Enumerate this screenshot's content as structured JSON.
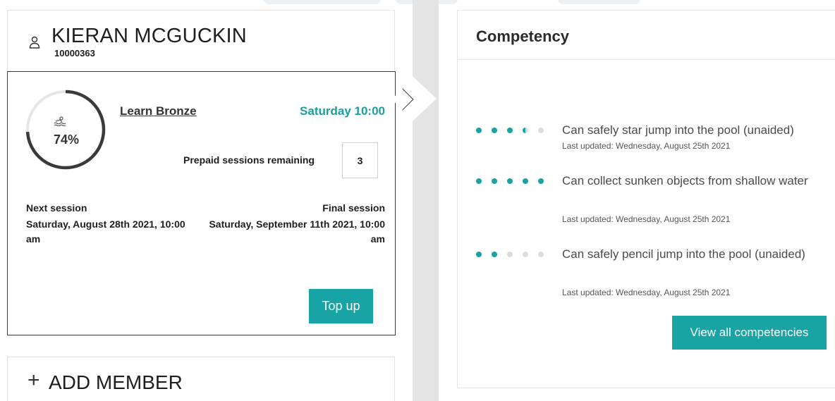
{
  "member": {
    "name": "KIERAN MCGUCKIN",
    "id": "10000363"
  },
  "course": {
    "name": "Learn Bronze",
    "time": "Saturday 10:00",
    "progress": 74,
    "progress_label": "74%",
    "prepaid_label": "Prepaid sessions remaining",
    "prepaid_count": "3",
    "next_label": "Next session",
    "next_value": "Saturday, August 28th 2021, 10:00 am",
    "final_label": "Final session",
    "final_value": "Saturday, September 11th 2021, 10:00 am",
    "topup_label": "Top up"
  },
  "add_member": {
    "label": "ADD MEMBER"
  },
  "competency": {
    "title": "Competency",
    "items": [
      {
        "text": "Can safely star jump into the pool (unaided)",
        "updated": "Last updated: Wednesday, August 25th 2021",
        "level": 3.5,
        "max": 5
      },
      {
        "text": "Can collect sunken objects from shallow water",
        "updated": "Last updated: Wednesday, August 25th 2021",
        "level": 5,
        "max": 5
      },
      {
        "text": "Can safely pencil jump into the pool (unaided)",
        "updated": "Last updated: Wednesday, August 25th 2021",
        "level": 2,
        "max": 5
      }
    ],
    "view_all_label": "View all competencies"
  },
  "colors": {
    "accent": "#18a3a5",
    "dot_empty": "#dcdcdc"
  }
}
